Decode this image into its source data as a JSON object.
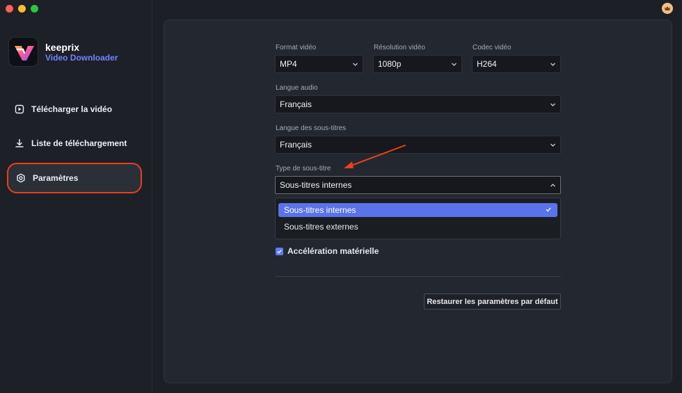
{
  "app": {
    "name": "keeprix",
    "subtitle": "Video Downloader",
    "accent": "#6f86ff"
  },
  "sidebar": {
    "items": [
      {
        "label": "Télécharger la vidéo",
        "icon": "play-square-icon",
        "active": false
      },
      {
        "label": "Liste de téléchargement",
        "icon": "download-icon",
        "active": false
      },
      {
        "label": "Paramètres",
        "icon": "gear-icon",
        "active": true
      }
    ]
  },
  "settings": {
    "format": {
      "label": "Format vidéo",
      "value": "MP4"
    },
    "resolution": {
      "label": "Résolution vidéo",
      "value": "1080p"
    },
    "codec": {
      "label": "Codec vidéo",
      "value": "H264"
    },
    "audio_lang": {
      "label": "Langue audio",
      "value": "Français"
    },
    "subtitle_lang": {
      "label": "Langue des sous-titres",
      "value": "Français"
    },
    "subtitle_type": {
      "label": "Type de sous-titre",
      "value": "Sous-titres internes",
      "options": [
        "Sous-titres internes",
        "Sous-titres externes"
      ]
    },
    "hardware_accel": {
      "label": "Accélération matérielle",
      "checked": true
    },
    "reset_label": "Restaurer les paramètres par défaut"
  },
  "colors": {
    "highlight_ring": "#e8401e",
    "selected_option": "#5b73ea"
  }
}
